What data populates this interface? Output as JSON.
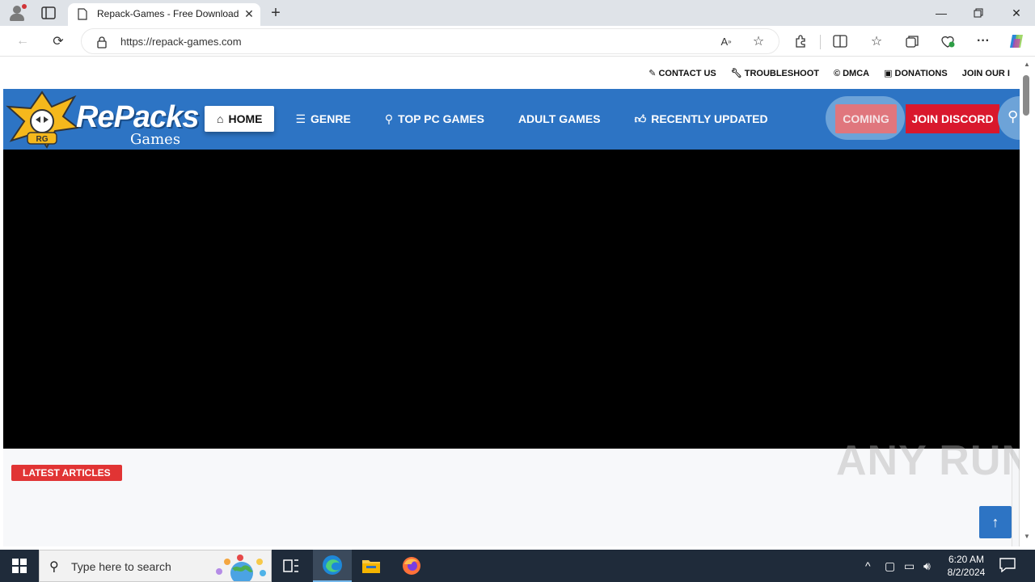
{
  "browser": {
    "tab_title": "Repack-Games - Free Download",
    "url": "https://repack-games.com"
  },
  "site": {
    "top_links": [
      {
        "icon": "edit-square-icon",
        "label": "CONTACT US"
      },
      {
        "icon": "wrench-icon",
        "label": "TROUBLESHOOT"
      },
      {
        "icon": "copyright-icon",
        "label": "DMCA"
      },
      {
        "icon": "money-icon",
        "label": "DONATIONS"
      },
      {
        "icon": "",
        "label": "JOIN OUR I"
      }
    ],
    "logo": {
      "wordmark": "RePacks",
      "sub": "Games",
      "badge": "RG"
    },
    "nav": [
      {
        "icon": "home-icon",
        "label": "HOME",
        "active": true
      },
      {
        "icon": "list-icon",
        "label": "GENRE",
        "active": false
      },
      {
        "icon": "gamepad-icon",
        "label": "TOP PC GAMES",
        "active": false
      },
      {
        "icon": "",
        "label": "ADULT GAMES",
        "active": false
      },
      {
        "icon": "thumbs-up-icon",
        "label": "RECENTLY UPDATED",
        "active": false
      }
    ],
    "coming_label": "COMING",
    "discord_label": "JOIN DISCORD",
    "latest_label": "LATEST ARTICLES",
    "watermark": "ANY RUN",
    "colors": {
      "nav_bg": "#2d74c4",
      "discord": "#d9182d",
      "latest": "#e13434"
    }
  },
  "taskbar": {
    "search_placeholder": "Type here to search",
    "time": "6:20 AM",
    "date": "8/2/2024"
  }
}
